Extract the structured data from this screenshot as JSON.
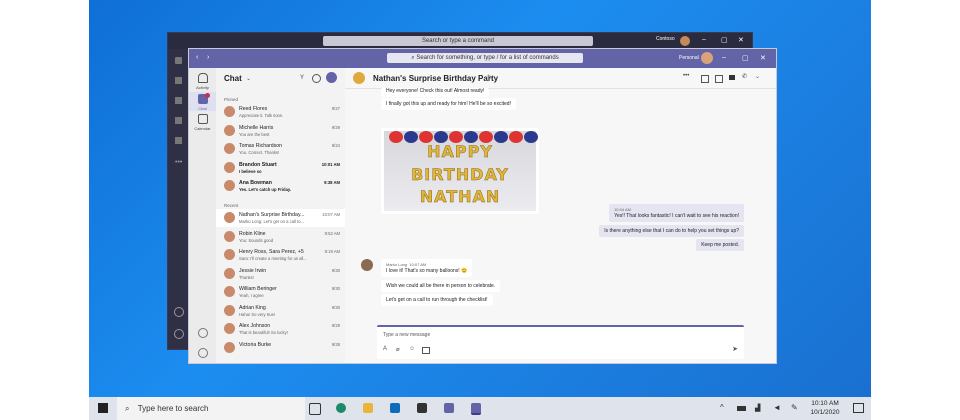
{
  "background_window": {
    "search_placeholder": "Search or type a command",
    "user_label": "Contoso"
  },
  "window": {
    "search_placeholder": "Search for something, or type / for a list of commands",
    "user_label": "Personal"
  },
  "left_nav": [
    {
      "label": "Activity",
      "icon": "bell-icon"
    },
    {
      "label": "Chat",
      "icon": "chat-icon"
    },
    {
      "label": "Calendar",
      "icon": "calendar-icon"
    }
  ],
  "chat_list": {
    "title": "Chat",
    "pinned_label": "Pinned",
    "recent_label": "Recent",
    "pinned": [
      {
        "name": "Reed Flores",
        "preview": "Appreciate it. Talk soon.",
        "time": "9/27"
      },
      {
        "name": "Michelle Harris",
        "preview": "You are the best",
        "time": "9/29"
      },
      {
        "name": "Tomas Richardson",
        "preview": "You. Correct. Thanks!",
        "time": "9/24"
      },
      {
        "name": "Brandon Stuart",
        "preview": "I believe so",
        "time": "10:01 AM"
      },
      {
        "name": "Ana Bowman",
        "preview": "Yes. Let's catch up Friday.",
        "time": "9:38 AM"
      }
    ],
    "recent": [
      {
        "name": "Nathan's Surprise Birthday...",
        "preview": "Marko Long: Let's get on a call to...",
        "time": "10:07 AM"
      },
      {
        "name": "Robin Kline",
        "preview": "You: Sounds good",
        "time": "9:52 AM"
      },
      {
        "name": "Henry Ross, Sara Perez, +5",
        "preview": "Sara: I'll create a meeting for us all...",
        "time": "9:19 AM"
      },
      {
        "name": "Jessie Irwin",
        "preview": "Thanks!",
        "time": "9/30"
      },
      {
        "name": "William Beringer",
        "preview": "Yeah, I agree",
        "time": "9/30"
      },
      {
        "name": "Adrian King",
        "preview": "Haha! So very true!",
        "time": "9/30"
      },
      {
        "name": "Alex Johnson",
        "preview": "That is beautiful! So lucky!",
        "time": "9/29"
      },
      {
        "name": "Victoria Burke",
        "preview": "",
        "time": "9/28"
      }
    ]
  },
  "conversation": {
    "title": "Nathan's Surprise Birthday Party",
    "first_message": "Hey everyone! Check this out! Almost ready!",
    "excited_message": "I finally got this up and ready for him! He'll be so excited!",
    "banner_lines": [
      "HAPPY",
      "BIRTHDAY",
      "NATHAN"
    ],
    "my_messages_time": "10:04 AM",
    "my_messages": [
      "Yes!! That looks fantastic! I can't wait to see his reaction!",
      "Is there anything else that I can do to help you set things up?",
      "Keep me posted."
    ],
    "marko": {
      "name": "Marko Long",
      "time": "10:07 AM",
      "messages": [
        "I love it! That's so many balloons! 😊",
        "Wish we could all be there in person to celebrate.",
        "Let's get on a call to run through the checklist!"
      ]
    },
    "compose_placeholder": "Type a new message"
  },
  "taskbar": {
    "search_placeholder": "Type here to search",
    "time": "10:10 AM",
    "date": "10/1/2020"
  },
  "colors": {
    "brand": "#6264a7",
    "desktop": "#1a7fe0"
  }
}
